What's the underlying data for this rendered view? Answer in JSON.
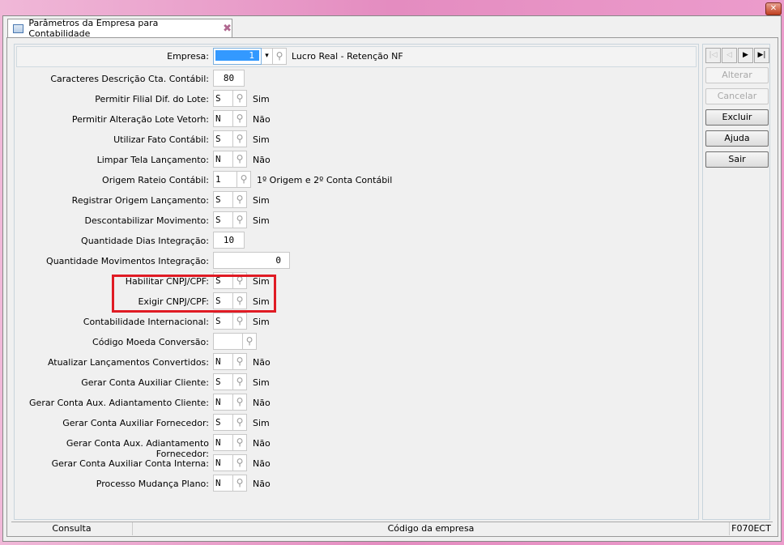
{
  "tab": {
    "title": "Parâmetros da Empresa para Contabilidade"
  },
  "header": {
    "label": "Empresa:",
    "value": "1",
    "description": "Lucro Real - Retenção NF"
  },
  "rows": [
    {
      "label": "Caracteres Descrição Cta. Contábil:",
      "value": "80",
      "desc": ""
    },
    {
      "label": "Permitir Filial Dif. do Lote:",
      "value": "S",
      "desc": "Sim"
    },
    {
      "label": "Permitir Alteração Lote Vetorh:",
      "value": "N",
      "desc": "Não"
    },
    {
      "label": "Utilizar Fato Contábil:",
      "value": "S",
      "desc": "Sim"
    },
    {
      "label": "Limpar Tela Lançamento:",
      "value": "N",
      "desc": "Não"
    },
    {
      "label": "Origem Rateio Contábil:",
      "value": "1",
      "desc": "1º Origem e 2º Conta Contábil"
    },
    {
      "label": "Registrar Origem Lançamento:",
      "value": "S",
      "desc": "Sim"
    },
    {
      "label": "Descontabilizar Movimento:",
      "value": "S",
      "desc": "Sim"
    },
    {
      "label": "Quantidade Dias Integração:",
      "value": "10",
      "desc": ""
    },
    {
      "label": "Quantidade Movimentos Integração:",
      "value": "0",
      "desc": ""
    },
    {
      "label": "Habilitar CNPJ/CPF:",
      "value": "S",
      "desc": "Sim"
    },
    {
      "label": "Exigir CNPJ/CPF:",
      "value": "S",
      "desc": "Sim"
    },
    {
      "label": "Contabilidade Internacional:",
      "value": "S",
      "desc": "Sim"
    },
    {
      "label": "Código Moeda Conversão:",
      "value": "",
      "desc": ""
    },
    {
      "label": "Atualizar Lançamentos Convertidos:",
      "value": "N",
      "desc": "Não"
    },
    {
      "label": "Gerar Conta Auxiliar Cliente:",
      "value": "S",
      "desc": "Sim"
    },
    {
      "label": "Gerar Conta Aux. Adiantamento Cliente:",
      "value": "N",
      "desc": "Não"
    },
    {
      "label": "Gerar Conta Auxiliar Fornecedor:",
      "value": "S",
      "desc": "Sim"
    },
    {
      "label": "Gerar Conta Aux. Adiantamento Fornecedor:",
      "value": "N",
      "desc": "Não"
    },
    {
      "label": "Gerar Conta Auxiliar Conta Interna:",
      "value": "N",
      "desc": "Não"
    },
    {
      "label": "Processo Mudança Plano:",
      "value": "N",
      "desc": "Não"
    }
  ],
  "buttons": {
    "alterar": "Alterar",
    "cancelar": "Cancelar",
    "excluir": "Excluir",
    "ajuda": "Ajuda",
    "sair": "Sair"
  },
  "status": {
    "mode": "Consulta",
    "hint": "Código da empresa",
    "code": "F070ECT"
  }
}
